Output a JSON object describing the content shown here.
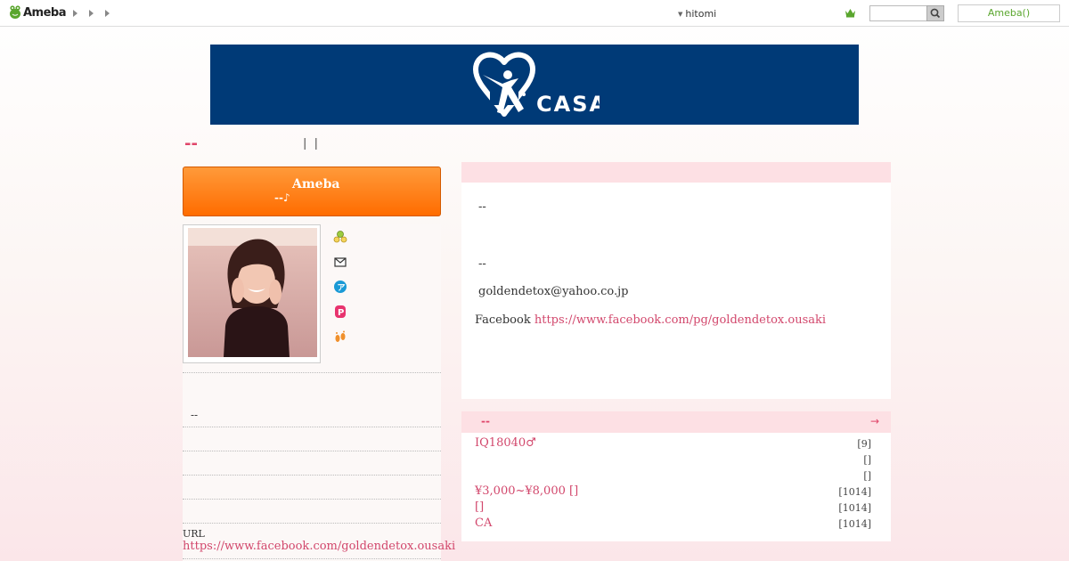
{
  "topbar": {
    "logo_text": "Ameba",
    "user_name": "hitomi",
    "search_placeholder": "",
    "ameba_button": "Ameba()"
  },
  "banner": {
    "brand_text": "CASA"
  },
  "blog_title": {
    "mark": "--",
    "separators": "|  |"
  },
  "promo": {
    "title": "Ameba",
    "subtitle": "--♪"
  },
  "sidebar": {
    "icons": [
      "reader-icon",
      "mail-icon",
      "app-icon",
      "pigg-icon",
      "footprint-icon"
    ],
    "dash_text": "--",
    "url_label": "URL",
    "url": "https://www.facebook.com/goldendetox.ousaki"
  },
  "profile_box": {
    "dash1": "--",
    "dash2": "--",
    "email": "goldendetox@yahoo.co.jp",
    "facebook_label": "Facebook",
    "facebook_url": "https://www.facebook.com/pg/goldendetox.ousaki"
  },
  "entries_box": {
    "header_mark": "--",
    "more_arrow": "→",
    "entries": [
      {
        "title": "IQ18040♂",
        "count": "[9]"
      },
      {
        "title": "",
        "count": "[]"
      },
      {
        "title": "",
        "count": "[]"
      },
      {
        "title": "¥3,000~¥8,000 []",
        "count": "[1014]"
      },
      {
        "title": " []",
        "count": "[1014]"
      },
      {
        "title": "CA",
        "count": "[1014]"
      }
    ]
  },
  "colors": {
    "accent_pink": "#d2476c",
    "banner_navy": "#003a77",
    "promo_orange": "#ff7a10",
    "ameba_green": "#5aa62e"
  }
}
